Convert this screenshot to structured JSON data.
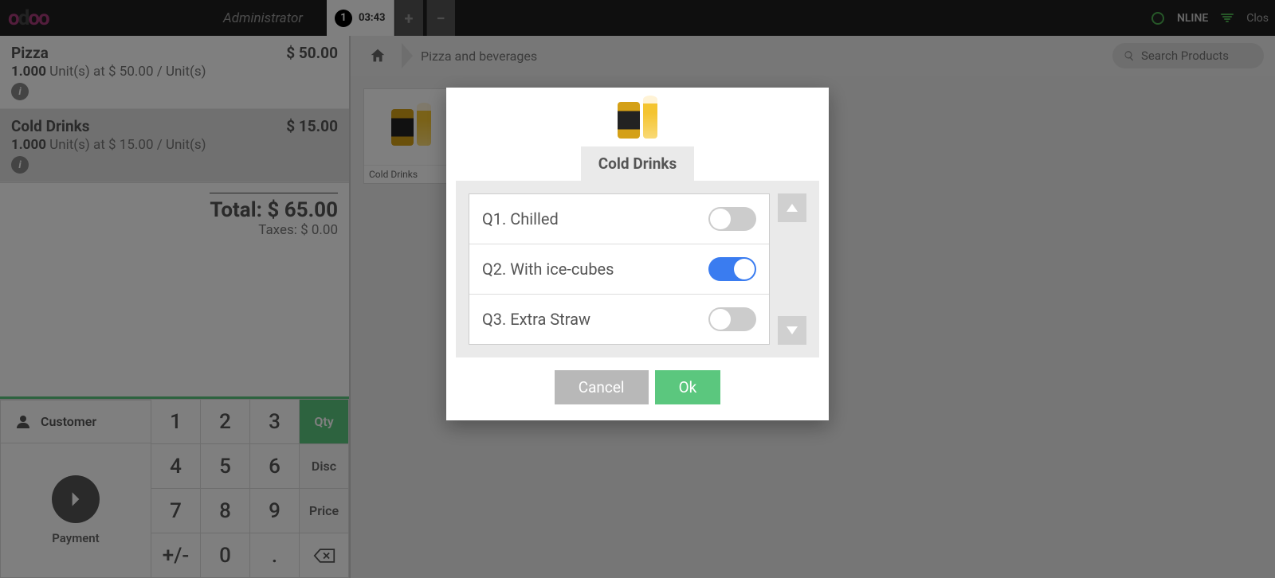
{
  "topbar": {
    "user": "Administrator",
    "order_number": "1",
    "order_time": "03:43",
    "status": "NLINE",
    "close": "Clos"
  },
  "order": {
    "lines": [
      {
        "name": "Pizza",
        "price": "$ 50.00",
        "qty": "1.000",
        "detail": "Unit(s) at $ 50.00 / Unit(s)"
      },
      {
        "name": "Cold Drinks",
        "price": "$ 15.00",
        "qty": "1.000",
        "detail": "Unit(s) at $ 15.00 / Unit(s)"
      }
    ],
    "total_label": "Total: ",
    "total_value": "$ 65.00",
    "taxes_label": "Taxes: ",
    "taxes_value": "$ 0.00"
  },
  "actions": {
    "customer": "Customer",
    "payment": "Payment"
  },
  "keypad": {
    "k1": "1",
    "k2": "2",
    "k3": "3",
    "qty": "Qty",
    "k4": "4",
    "k5": "5",
    "k6": "6",
    "disc": "Disc",
    "k7": "7",
    "k8": "8",
    "k9": "9",
    "price": "Price",
    "sign": "+/-",
    "k0": "0",
    "dot": "."
  },
  "breadcrumb": {
    "category": "Pizza and beverages"
  },
  "search": {
    "placeholder": "Search Products"
  },
  "products": [
    {
      "label": "Cold Drinks"
    }
  ],
  "modal": {
    "title": "Cold Drinks",
    "options": [
      {
        "label": "Q1. Chilled",
        "on": false
      },
      {
        "label": "Q2. With ice-cubes",
        "on": true
      },
      {
        "label": "Q3. Extra Straw",
        "on": false
      }
    ],
    "cancel": "Cancel",
    "ok": "Ok"
  }
}
